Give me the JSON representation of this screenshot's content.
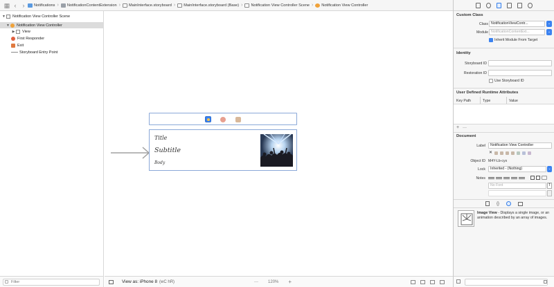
{
  "jumpbar": {
    "crumbs": [
      "Notifications",
      "NotificationContentExtension",
      "MainInterface.storyboard",
      "MainInterface.storyboard (Base)",
      "Notification View Controller Scene",
      "Notification View Controller"
    ]
  },
  "navigator": {
    "items": [
      {
        "label": "Notification View Controller Scene"
      },
      {
        "label": "Notification View Controller"
      },
      {
        "label": "View"
      },
      {
        "label": "First Responder"
      },
      {
        "label": "Exit"
      },
      {
        "label": "Storyboard Entry Point"
      }
    ],
    "filter_placeholder": "Filter"
  },
  "canvas": {
    "title": "Title",
    "subtitle": "Subtitle",
    "body": "Body",
    "view_as": "View as: iPhone 8",
    "view_as_shortcut": "(wC hR)",
    "zoom": "120%",
    "zoom_out": "—",
    "zoom_in": "+"
  },
  "inspector": {
    "custom_class": {
      "header": "Custom Class",
      "class_label": "Class",
      "class_value": "NotificationViewContr...",
      "module_label": "Module",
      "module_value": "NotificationContentExt...",
      "inherit_label": "Inherit Module From Target"
    },
    "identity": {
      "header": "Identity",
      "storyboard_id_label": "Storyboard ID",
      "restoration_id_label": "Restoration ID",
      "use_storyboard_id_label": "Use Storyboard ID"
    },
    "runtime_attrs": {
      "header": "User Defined Runtime Attributes",
      "columns": [
        "Key Path",
        "Type",
        "Value"
      ],
      "add": "+",
      "remove": "—"
    },
    "document": {
      "header": "Document",
      "label_label": "Label",
      "label_value": "Notification View Controller",
      "object_id_label": "Object ID",
      "object_id_value": "M4Y-Lb-cyx",
      "lock_label": "Lock",
      "lock_value": "Inherited - (Nothing)",
      "notes_label": "Notes",
      "font_placeholder": "No Font",
      "x_mark": "✕"
    },
    "library": {
      "title": "Image View",
      "description": " - Displays a single image, or an animation described by an array of images."
    }
  }
}
